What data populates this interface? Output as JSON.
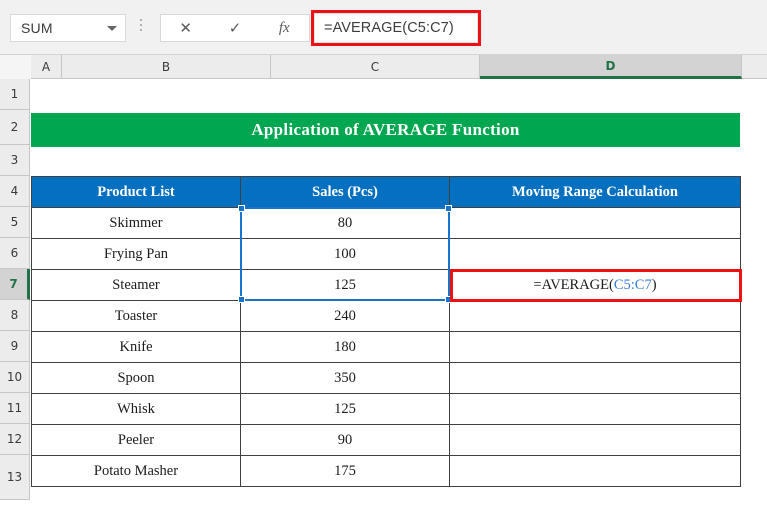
{
  "formula_bar": {
    "name_box_value": "SUM",
    "name_box_dropdown_icon": "chevron-down-icon",
    "cancel_icon": "✕",
    "enter_icon": "✓",
    "insert_function_icon": "fx",
    "formula_value": "=AVERAGE(C5:C7)",
    "annotation_color": "#ee1111"
  },
  "columns": [
    {
      "label": "A",
      "active": false
    },
    {
      "label": "B",
      "active": false
    },
    {
      "label": "C",
      "active": false
    },
    {
      "label": "D",
      "active": true
    }
  ],
  "rows": [
    {
      "label": "1",
      "active": false
    },
    {
      "label": "2",
      "active": false
    },
    {
      "label": "3",
      "active": false
    },
    {
      "label": "4",
      "active": false
    },
    {
      "label": "5",
      "active": false
    },
    {
      "label": "6",
      "active": false
    },
    {
      "label": "7",
      "active": true
    },
    {
      "label": "8",
      "active": false
    },
    {
      "label": "9",
      "active": false
    },
    {
      "label": "10",
      "active": false
    },
    {
      "label": "11",
      "active": false
    },
    {
      "label": "12",
      "active": false
    },
    {
      "label": "13",
      "active": false
    }
  ],
  "sheet": {
    "banner_title": "Application of AVERAGE Function",
    "banner_color": "#00a650",
    "header_color": "#0570c0",
    "active_cell": "D7",
    "selected_range": "C5:C7",
    "table": {
      "headers": [
        "Product List",
        "Sales (Pcs)",
        "Moving Range Calculation"
      ],
      "rows": [
        {
          "product": "Skimmer",
          "sales": "80",
          "moving": ""
        },
        {
          "product": "Frying Pan",
          "sales": "100",
          "moving": ""
        },
        {
          "product": "Steamer",
          "sales": "125",
          "moving": ""
        },
        {
          "product": "Toaster",
          "sales": "240",
          "moving": ""
        },
        {
          "product": "Knife",
          "sales": "180",
          "moving": ""
        },
        {
          "product": "Spoon",
          "sales": "350",
          "moving": ""
        },
        {
          "product": "Whisk",
          "sales": "125",
          "moving": ""
        },
        {
          "product": "Peeler",
          "sales": "90",
          "moving": ""
        },
        {
          "product": "Potato Masher",
          "sales": "175",
          "moving": ""
        }
      ],
      "formula_cell": {
        "row_index": 2,
        "prefix": "=AVERAGE(",
        "reference": "C5:C7",
        "suffix": ")"
      }
    }
  }
}
